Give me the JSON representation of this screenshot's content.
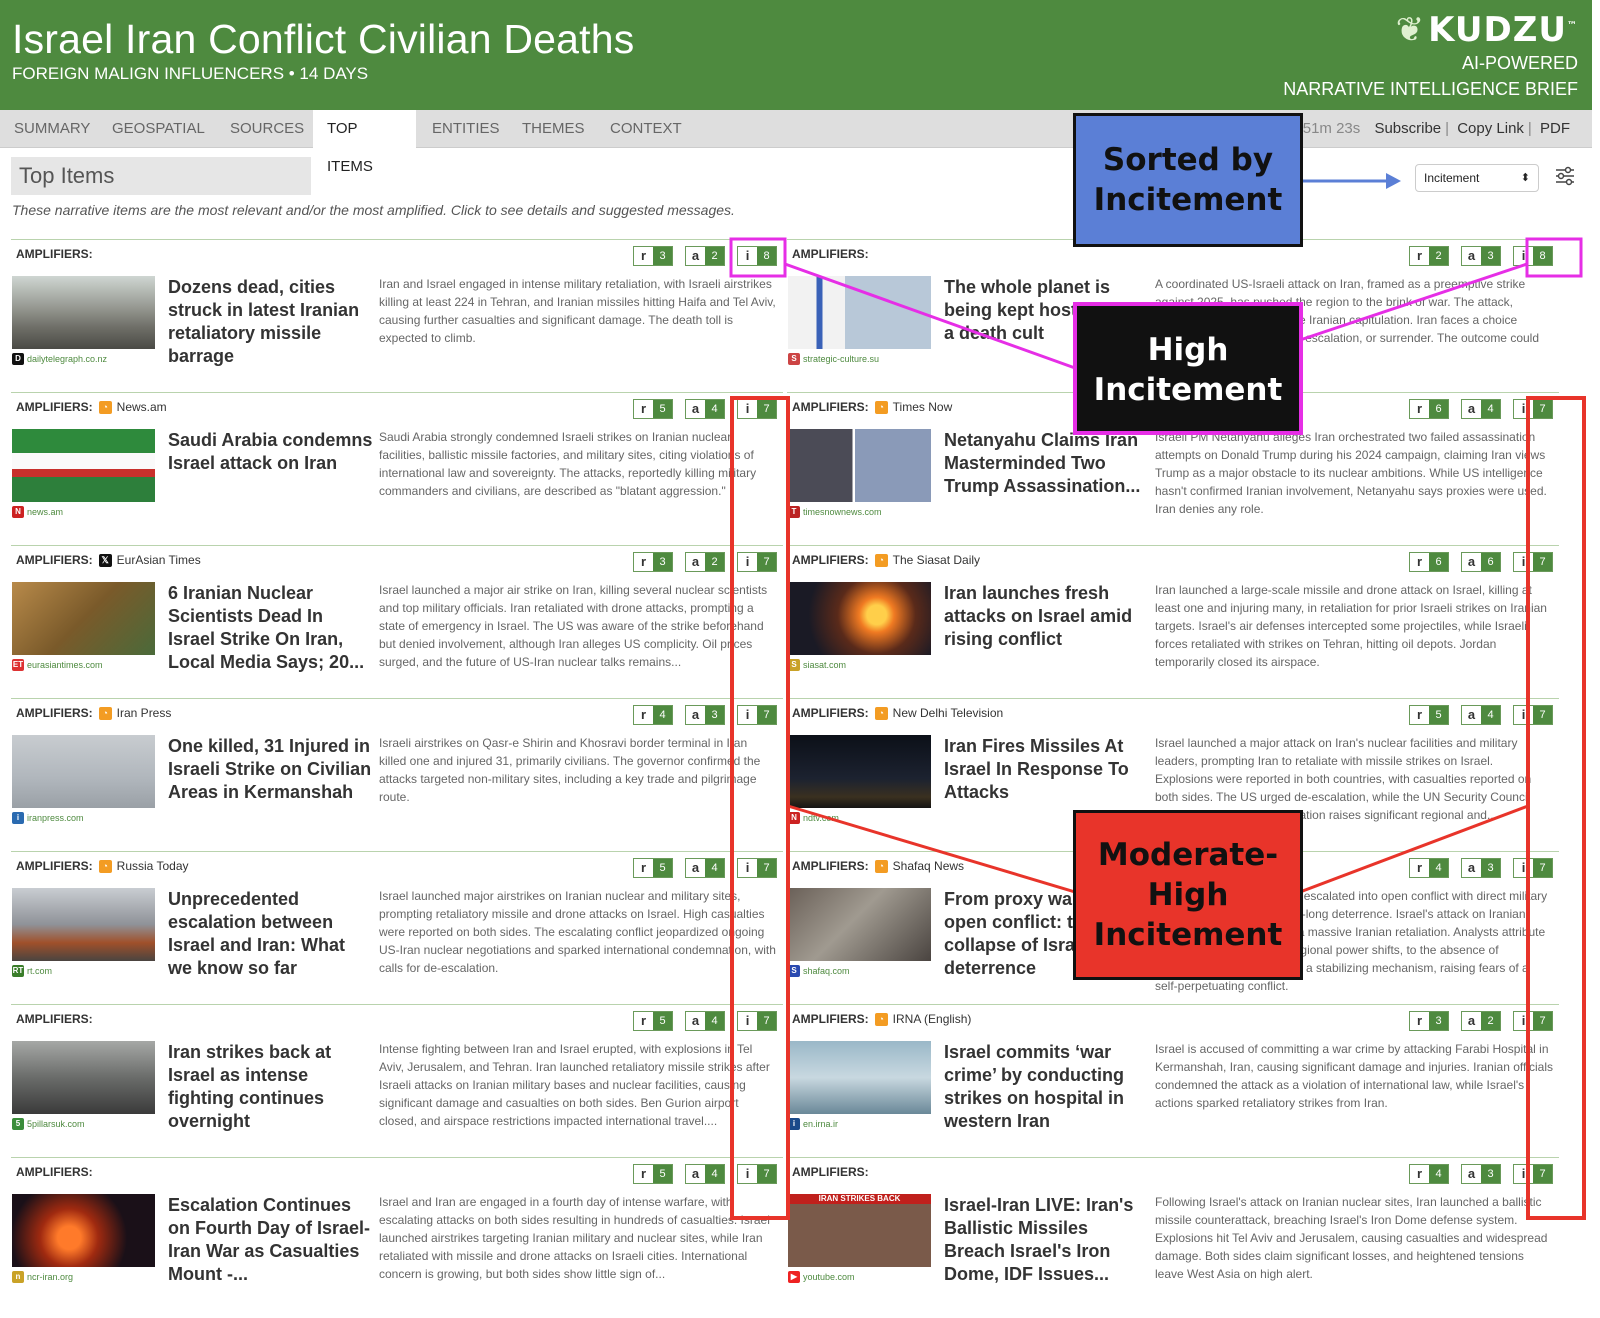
{
  "header": {
    "title": "Israel Iran Conflict Civilian Deaths",
    "subtitle": "FOREIGN MALIGN INFLUENCERS  •  14 DAYS",
    "brand": "KUDZU",
    "tm": "™",
    "brand_line1": "AI-POWERED",
    "brand_line2": "NARRATIVE INTELLIGENCE BRIEF"
  },
  "nav": {
    "tabs": [
      "SUMMARY",
      "GEOSPATIAL",
      "SOURCES",
      "TOP ITEMS",
      "ENTITIES",
      "THEMES",
      "CONTEXT"
    ],
    "active": "TOP ITEMS",
    "timer": "h 51m 23s",
    "links": [
      "Subscribe",
      "Copy Link",
      "PDF"
    ]
  },
  "section": {
    "title": "Top Items",
    "description": "These narrative items are the most relevant and/or the most amplified. Click to see details and suggested messages.",
    "sort_value": "Incitement"
  },
  "amp_label": "AMPLIFIERS:",
  "badge_letters": [
    "r",
    "a",
    "i"
  ],
  "items": [
    {
      "source": "",
      "source_icon": "",
      "r": 3,
      "a": 2,
      "i": 8,
      "headline": "Dozens dead, cities struck in latest Iranian retaliatory missile barrage",
      "domain": "dailytelegraph.co.nz",
      "domain_icon": "D",
      "domain_color": "#111",
      "summary": "Iran and Israel engaged in intense military retaliation, with Israeli airstrikes killing at least 224 in Tehran, and Iranian missiles hitting Haifa and Tel Aviv, causing further casualties and significant damage. The death toll is expected to climb.",
      "thumb": "rubble"
    },
    {
      "source": "",
      "source_icon": "",
      "r": 2,
      "a": 3,
      "i": 8,
      "headline": "The whole planet is being kept hostage by a death cult",
      "domain": "strategic-culture.su",
      "domain_icon": "S",
      "domain_color": "#c44",
      "summary": "A coordinated US-Israeli attack on Iran, framed as a preemptive strike against 2025, has pushed the region to the brink of war. The attack, analysts claim, aims to force Iranian capitulation. Iran faces a choice between retaliation, nuclear escalation, or surrender. The outcome could be catastrophic.",
      "thumb": "jet"
    },
    {
      "source": "News.am",
      "source_icon": "rss",
      "r": 5,
      "a": 4,
      "i": 7,
      "headline": "Saudi Arabia condemns Israel attack on Iran",
      "domain": "news.am",
      "domain_icon": "N",
      "domain_color": "#c22",
      "summary": "Saudi Arabia strongly condemned Israeli strikes on Iranian nuclear facilities, ballistic missile factories, and military sites, citing violations of international law and sovereignty. The attacks, reportedly killing military commanders and civilians, are described as \"blatant aggression.\"",
      "thumb": "flags"
    },
    {
      "source": "Times Now",
      "source_icon": "rss",
      "r": 6,
      "a": 4,
      "i": 7,
      "headline": "Netanyahu Claims Iran Masterminded Two Trump Assassination...",
      "domain": "timesnownews.com",
      "domain_icon": "T",
      "domain_color": "#b22",
      "summary": "Israeli PM Netanyahu alleges Iran orchestrated two failed assassination attempts on Donald Trump during his 2024 campaign, claiming Iran views Trump as a major obstacle to its nuclear ambitions. While US intelligence hasn't confirmed Iranian involvement, Netanyahu says proxies were used. Iran denies any role.",
      "thumb": "portraits"
    },
    {
      "source": "EurAsian Times",
      "source_icon": "x",
      "r": 3,
      "a": 2,
      "i": 7,
      "headline": "6 Iranian Nuclear Scientists Dead In Israel Strike On Iran, Local Media Says; 20...",
      "domain": "eurasiantimes.com",
      "domain_icon": "ET",
      "domain_color": "#d33",
      "summary": "Israel launched a major air strike on Iran, killing several nuclear scientists and top military officials. Iran retaliated with drone attacks, prompting a state of emergency in Israel. The US was aware of the strike beforehand but denied involvement, although Iran alleges US complicity. Oil prices surged, and the future of US-Iran nuclear talks remains...",
      "thumb": "lion"
    },
    {
      "source": "The Siasat Daily",
      "source_icon": "rss",
      "r": 6,
      "a": 6,
      "i": 7,
      "headline": "Iran launches fresh attacks on Israel amid rising conflict",
      "domain": "siasat.com",
      "domain_icon": "S",
      "domain_color": "#c9a227",
      "summary": "Iran launched a large-scale missile and drone attack on Israel, killing at least one and injuring many, in retaliation for prior Israeli strikes on Iranian targets. Israel's air defenses intercepted some projectiles, while Israeli forces retaliated with strikes on Tehran, hitting oil depots. Jordan temporarily closed its airspace.",
      "thumb": "fire"
    },
    {
      "source": "Iran Press",
      "source_icon": "rss",
      "r": 4,
      "a": 3,
      "i": 7,
      "headline": "One killed, 31 Injured in Israeli Strike on Civilian Areas in Kermanshah",
      "domain": "iranpress.com",
      "domain_icon": "i",
      "domain_color": "#2a6ab0",
      "summary": "Israeli airstrikes on Qasr-e Shirin and Khosravi border terminal in Iran killed one and injured 31, primarily civilians. The governor confirmed the attacks targeted non-military sites, including a key trade and pilgrimage route.",
      "thumb": "sky"
    },
    {
      "source": "New Delhi Television",
      "source_icon": "rss",
      "r": 5,
      "a": 4,
      "i": 7,
      "headline": "Iran Fires Missiles At Israel In Response To Attacks",
      "domain": "ndtv.com",
      "domain_icon": "N",
      "domain_color": "#c22",
      "summary": "Israel launched a major attack on Iran's nuclear facilities and military leaders, prompting Iran to retaliate with missile strikes on Israel. Explosions were reported in both countries, with casualties reported on both sides. The US urged de-escalation, while the UN Security Council called for restraint. The situation raises significant regional and...",
      "thumb": "night"
    },
    {
      "source": "Russia Today",
      "source_icon": "rss",
      "r": 5,
      "a": 4,
      "i": 7,
      "headline": "Unprecedented escalation between Israel and Iran: What we know so far",
      "domain": "rt.com",
      "domain_icon": "RT",
      "domain_color": "#3a7d2a",
      "summary": "Israel launched major airstrikes on Iranian nuclear and military sites, prompting retaliatory missile and drone attacks on Israel. High casualties were reported on both sides. The escalating conflict jeopardized ongoing US-Iran nuclear negotiations and sparked international condemnation, with calls for de-escalation.",
      "thumb": "smoke"
    },
    {
      "source": "Shafaq News",
      "source_icon": "rss",
      "r": 4,
      "a": 3,
      "i": 7,
      "headline": "From proxy war to open conflict: the collapse of Israeli deterrence",
      "domain": "shafaq.com",
      "domain_icon": "S",
      "domain_color": "#2a4ab0",
      "summary": "The Israel-Iran shadow war escalated into open conflict with direct military strikes, shattering a decade-long deterrence. Israel's attack on Iranian nuclear facilities prompted a massive Iranian retaliation. Analysts attribute this escalation, driven by regional power shifts, to the absence of diplomacy. The region lacks a stabilizing mechanism, raising fears of a self-perpetuating conflict.",
      "thumb": "building"
    },
    {
      "source": "",
      "source_icon": "",
      "r": 5,
      "a": 4,
      "i": 7,
      "headline": "Iran strikes back at Israel as intense fighting continues overnight",
      "domain": "5pillarsuk.com",
      "domain_icon": "5",
      "domain_color": "#3a8d3a",
      "summary": "Intense fighting between Iran and Israel erupted, with explosions in Tel Aviv, Jerusalem, and Tehran. Iran launched retaliatory missile strikes after Israeli attacks on Iranian military bases and nuclear facilities, causing significant damage and casualties on both sides. Ben Gurion airport closed, and airspace restrictions impacted international travel....",
      "thumb": "ruins"
    },
    {
      "source": "IRNA (English)",
      "source_icon": "rss",
      "r": 3,
      "a": 2,
      "i": 7,
      "headline": "Israel commits ‘war crime’ by conducting strikes on hospital in western Iran",
      "domain": "en.irna.ir",
      "domain_icon": "i",
      "domain_color": "#1a4a8a",
      "summary": "Israel is accused of committing a war crime by attacking Farabi Hospital in Kermanshah, Iran, causing significant damage and injuries. Iranian officials condemned the attack as a violation of international law, while Israel's actions sparked retaliatory strikes from Iran.",
      "thumb": "hospital"
    },
    {
      "source": "",
      "source_icon": "",
      "r": 5,
      "a": 4,
      "i": 7,
      "headline": "Escalation Continues on Fourth Day of Israel-Iran War as Casualties Mount -...",
      "domain": "ncr-iran.org",
      "domain_icon": "n",
      "domain_color": "#c9a227",
      "summary": "Israel and Iran are engaged in a fourth day of intense warfare, with escalating attacks on both sides resulting in hundreds of casualties. Israel launched airstrikes targeting Iranian military and nuclear sites, while Iran retaliated with missile and drone attacks on Israeli cities. International concern is growing, but both sides show little sign of...",
      "thumb": "blaze"
    },
    {
      "source": "",
      "source_icon": "",
      "r": 4,
      "a": 3,
      "i": 7,
      "headline": "Israel-Iran LIVE: Iran's Ballistic Missiles Breach Israel's Iron Dome, IDF Issues...",
      "domain": "youtube.com",
      "domain_icon": "▶",
      "domain_color": "#e22",
      "summary": "Following Israel's attack on Iranian nuclear sites, Iran launched a ballistic missile counterattack, breaching Israel's Iron Dome defense system. Explosions hit Tel Aviv and Jerusalem, causing casualties and widespread damage. Both sides claim significant losses, and heightened tensions leave West Asia on high alert.",
      "thumb": "youtube",
      "thumb_caption": "IRAN STRIKES BACK"
    }
  ],
  "annotations": {
    "sorted": "Sorted by Incitement",
    "high": "High Incitement",
    "moderate": "Moderate-High Incitement"
  },
  "colors": {
    "header_green": "#4e8a3f",
    "annotation_blue": "#5b7fd6",
    "annotation_red": "#e8342a",
    "highlight_magenta": "#e62ee6",
    "highlight_red": "#e8342a"
  }
}
